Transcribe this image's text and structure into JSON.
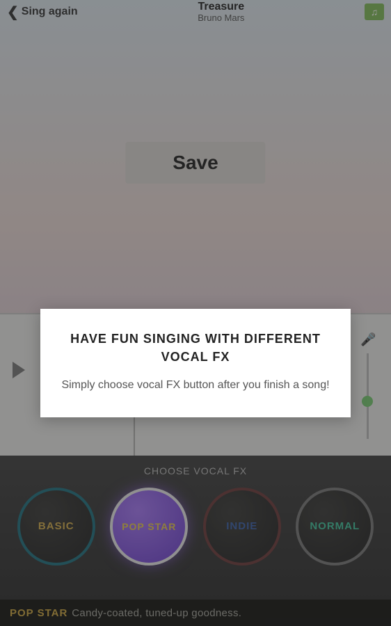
{
  "header": {
    "back_label": "Sing again",
    "song_title": "Treasure",
    "artist": "Bruno Mars"
  },
  "save_button": "Save",
  "fx": {
    "header": "CHOOSE VOCAL FX",
    "options": {
      "basic": "BASIC",
      "popstar": "POP\nSTAR",
      "indie": "INDIE",
      "normal": "NORMAL"
    },
    "selected": "popstar"
  },
  "footer": {
    "name": "POP STAR",
    "desc": "Candy-coated, tuned-up goodness."
  },
  "modal": {
    "title": "HAVE FUN SINGING WITH DIFFERENT VOCAL FX",
    "body": "Simply choose vocal FX button after you finish a song!"
  }
}
